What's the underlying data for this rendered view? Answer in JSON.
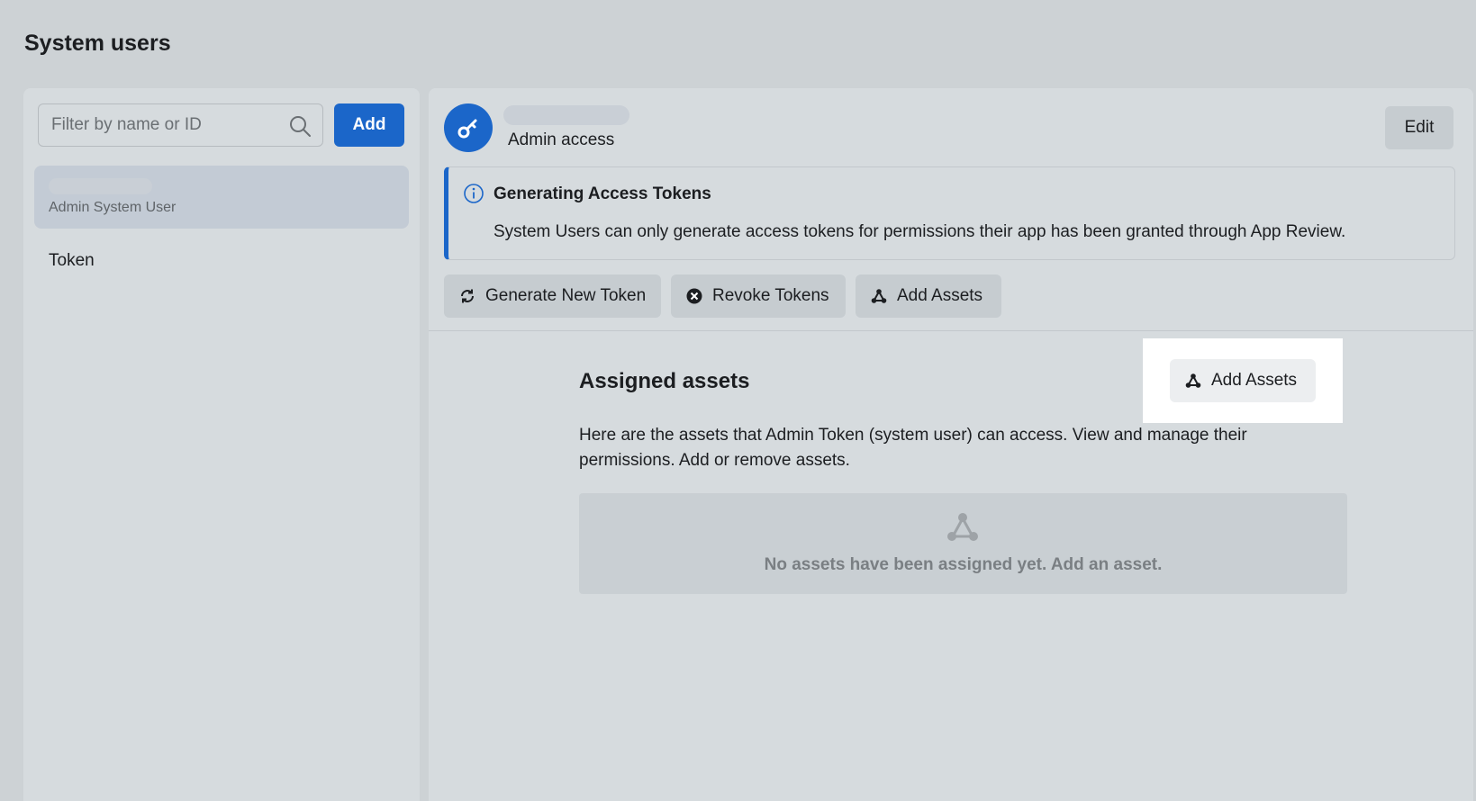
{
  "page": {
    "title": "System users"
  },
  "sidebar": {
    "search_placeholder": "Filter by name or ID",
    "add_label": "Add",
    "selected_user": {
      "role": "Admin System User"
    },
    "items": [
      {
        "label": "Token"
      }
    ]
  },
  "detail": {
    "access_label": "Admin access",
    "edit_label": "Edit",
    "banner": {
      "title": "Generating Access Tokens",
      "text": "System Users can only generate access tokens for permissions their app has been granted through App Review."
    },
    "actions": {
      "generate": "Generate New Token",
      "revoke": "Revoke Tokens",
      "add_assets": "Add Assets"
    },
    "assets": {
      "title": "Assigned assets",
      "add_label": "Add Assets",
      "description": "Here are the assets that Admin Token (system user) can access. View and manage their permissions. Add or remove assets.",
      "empty_text": "No assets have been assigned yet. Add an asset."
    }
  },
  "colors": {
    "accent": "#1b66c9",
    "background": "#cdd2d5",
    "panel": "#d6dbde"
  },
  "icons": [
    "search-icon",
    "key-icon",
    "info-icon",
    "refresh-icon",
    "close-circle-icon",
    "assets-icon"
  ]
}
